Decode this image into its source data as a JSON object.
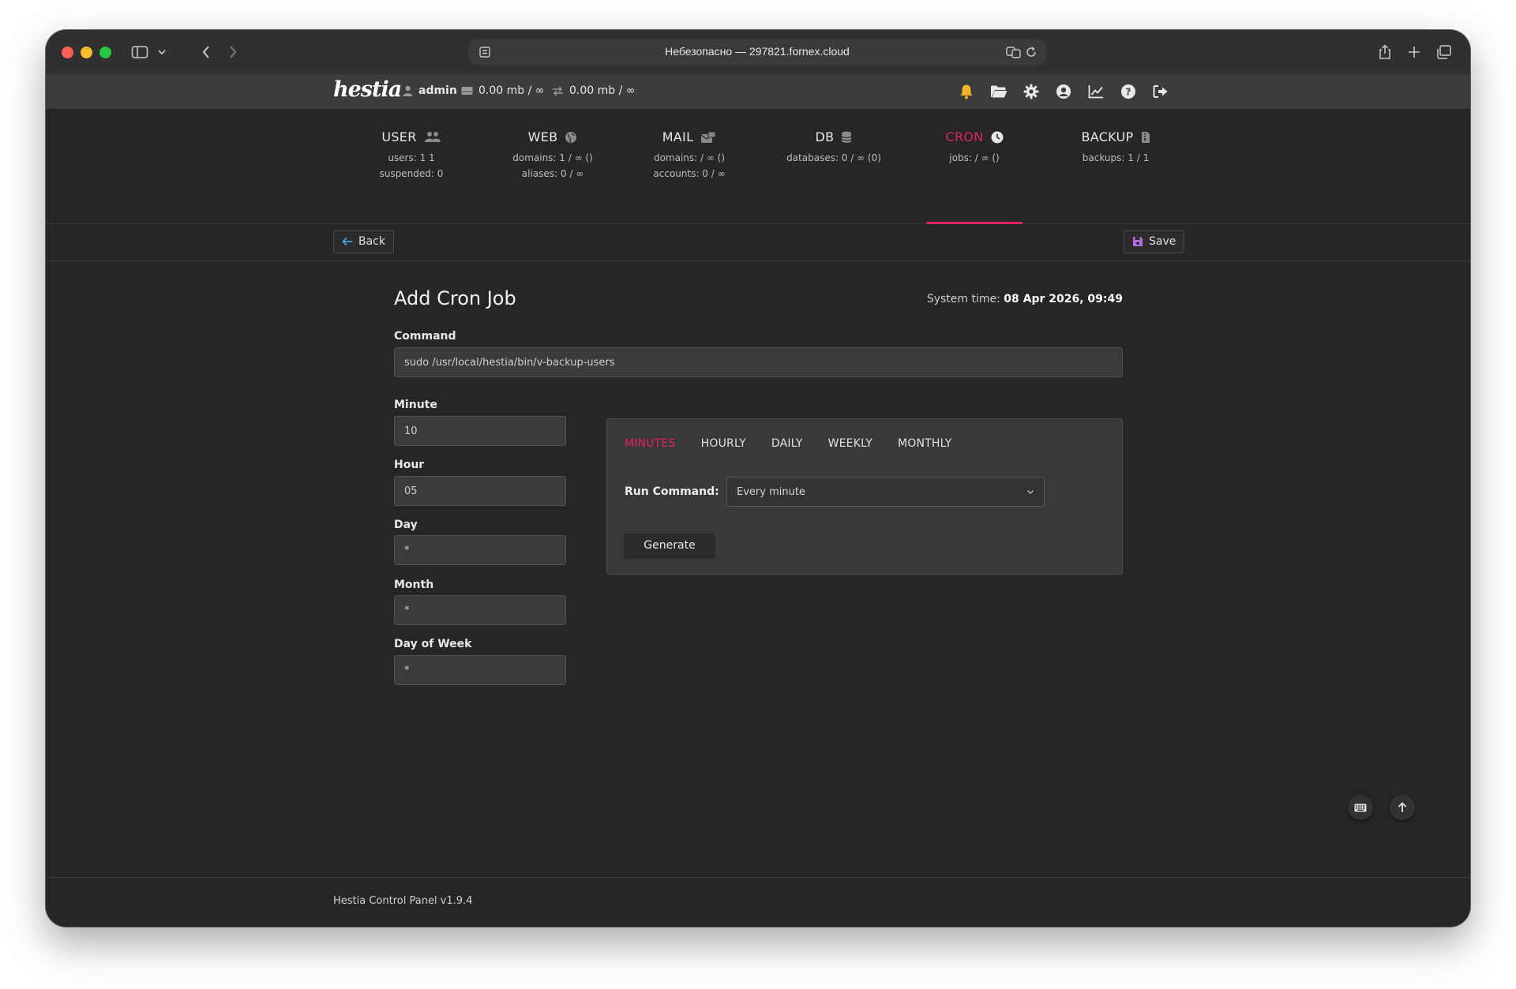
{
  "browser": {
    "url_display": "Небезопасно — 297821.fornex.cloud"
  },
  "topbar": {
    "logo": "hestia",
    "user": "admin",
    "disk": "0.00 mb / ∞",
    "bandwidth": "0.00 mb / ∞"
  },
  "stats": [
    {
      "label": "USER",
      "line1": "users: 1 1",
      "line2": "suspended: 0"
    },
    {
      "label": "WEB",
      "line1": "domains: 1 / ∞ ()",
      "line2": "aliases: 0 / ∞"
    },
    {
      "label": "MAIL",
      "line1": "domains: / ∞ ()",
      "line2": "accounts: 0 / ∞"
    },
    {
      "label": "DB",
      "line1": "databases: 0 / ∞ (0)",
      "line2": ""
    },
    {
      "label": "CRON",
      "line1": "jobs: / ∞ ()",
      "line2": ""
    },
    {
      "label": "BACKUP",
      "line1": "backups: 1 / 1",
      "line2": ""
    }
  ],
  "toolbar": {
    "back_label": "Back",
    "save_label": "Save"
  },
  "form": {
    "title": "Add Cron Job",
    "system_time_label": "System time:",
    "system_time_value": "08 Apr 2026, 09:49",
    "command_label": "Command",
    "command_value": "sudo /usr/local/hestia/bin/v-backup-users",
    "minute_label": "Minute",
    "minute_value": "10",
    "hour_label": "Hour",
    "hour_value": "05",
    "day_label": "Day",
    "day_value": "*",
    "month_label": "Month",
    "month_value": "*",
    "dow_label": "Day of Week",
    "dow_value": "*"
  },
  "generator": {
    "tabs": [
      "MINUTES",
      "HOURLY",
      "DAILY",
      "WEEKLY",
      "MONTHLY"
    ],
    "active_tab": "MINUTES",
    "run_label": "Run Command:",
    "run_value": "Every minute",
    "generate_label": "Generate"
  },
  "footer": {
    "text": "Hestia Control Panel v1.9.4"
  },
  "colors": {
    "accent": "#e0245e",
    "bell": "#f0b429"
  }
}
